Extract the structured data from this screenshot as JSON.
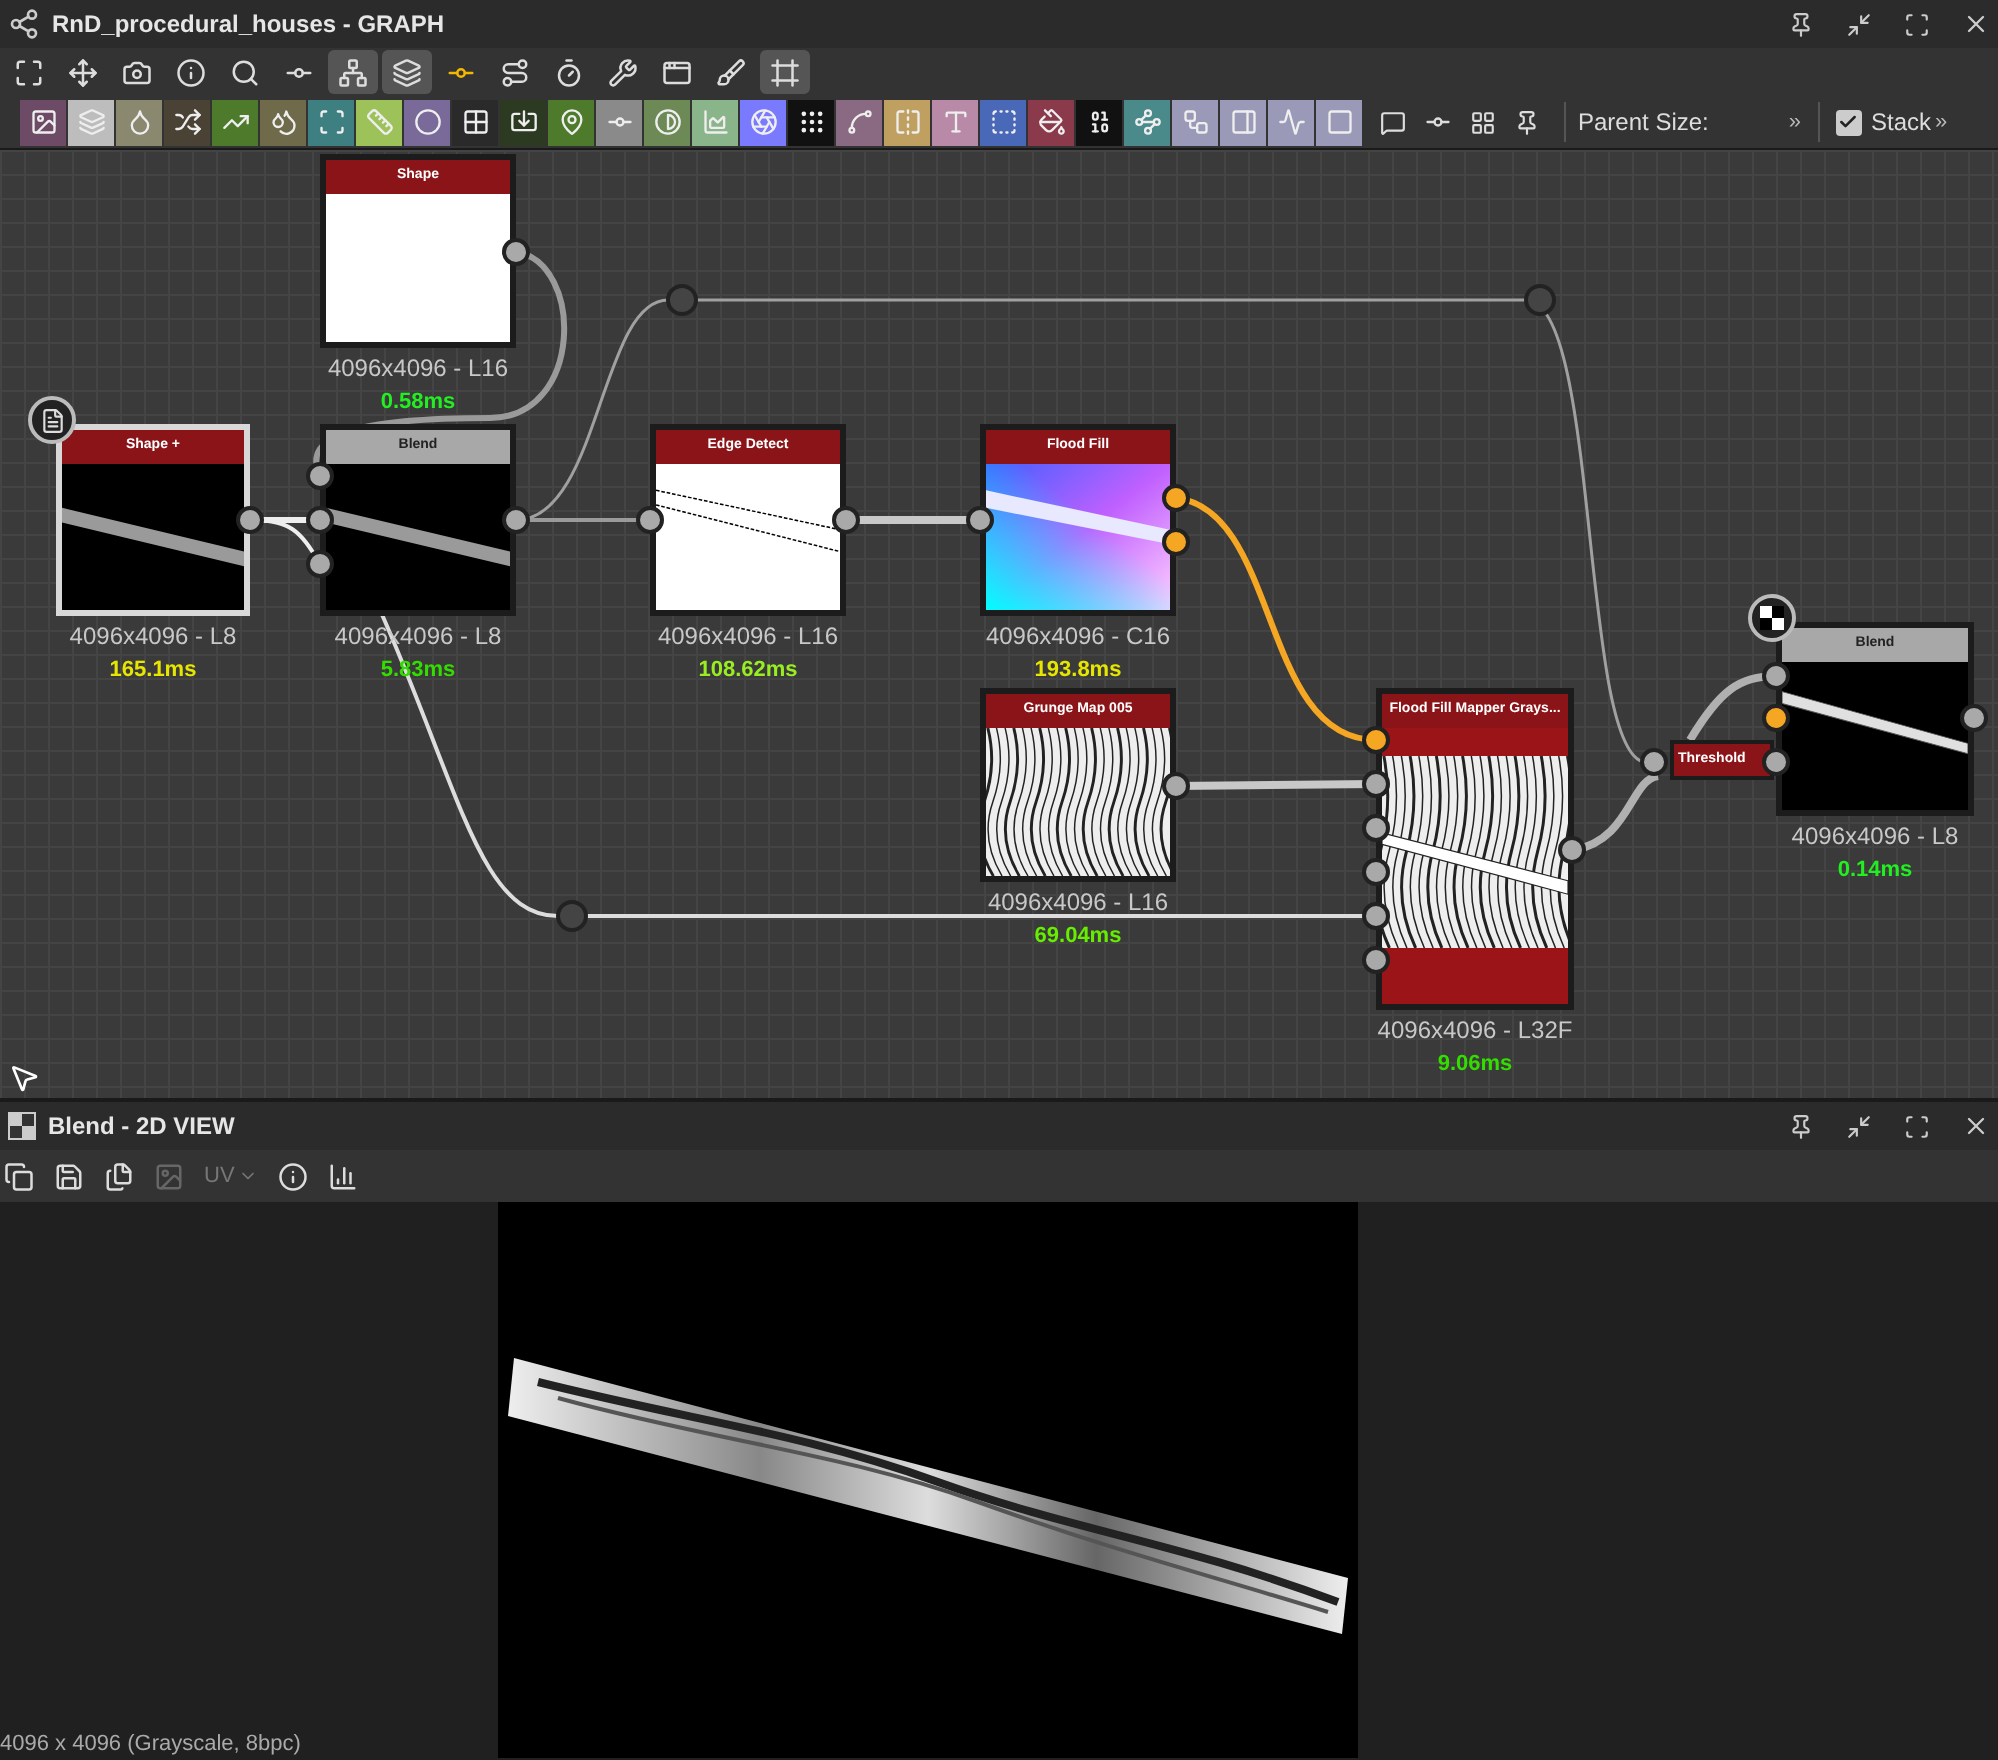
{
  "window": {
    "title": "RnD_procedural_houses - GRAPH"
  },
  "graph_toolbar": [
    {
      "selected": false
    },
    {
      "selected": false
    },
    {
      "selected": false
    },
    {
      "selected": false
    },
    {
      "selected": false
    },
    {
      "selected": false
    },
    {
      "selected": true
    },
    {
      "selected": true
    },
    {
      "selected": false
    },
    {
      "selected": false
    },
    {
      "selected": false
    },
    {
      "selected": false
    },
    {
      "selected": false
    },
    {
      "selected": false
    },
    {
      "selected": true
    }
  ],
  "node_palette": [
    {
      "color": "#6d4a66"
    },
    {
      "color": "#bdbdbd"
    },
    {
      "color": "#8b8870"
    },
    {
      "color": "#4a4234"
    },
    {
      "color": "#4e7a2c"
    },
    {
      "color": "#6f6a4a"
    },
    {
      "color": "#3e7f82"
    },
    {
      "color": "#9ec25a"
    },
    {
      "color": "#7a6a9a"
    },
    {
      "color": "#2a2a2a"
    },
    {
      "color": "#2c3a22"
    },
    {
      "color": "#4e7a2c"
    },
    {
      "color": "#8a8a8a"
    },
    {
      "color": "#6d8a56"
    },
    {
      "color": "#8ab48a"
    },
    {
      "color": "#7a7aff"
    },
    {
      "color": "#111111"
    },
    {
      "color": "#8a6a82"
    },
    {
      "color": "#c0a060"
    },
    {
      "color": "#b88aa8"
    },
    {
      "color": "#4a68b8"
    },
    {
      "color": "#8a3a4a"
    },
    {
      "color": "#111111"
    },
    {
      "color": "#4a8a8a"
    },
    {
      "color": "#9a9ab8"
    },
    {
      "color": "#9a9ab8"
    },
    {
      "color": "#9a9ab8"
    },
    {
      "color": "#9a9ab8"
    }
  ],
  "parent_size": {
    "label": "Parent Size:",
    "more": "»"
  },
  "stack": {
    "label": "Stack",
    "checked": true,
    "more": "»"
  },
  "nodes": [
    {
      "kind": "shape",
      "title": "Shape",
      "resolution": "4096x4096 - L16",
      "time": "0.58ms",
      "color": "#22ee22",
      "selected": false
    },
    {
      "kind": "shape_plus",
      "title": "Shape +",
      "resolution": "4096x4096 - L8",
      "time": "165.1ms",
      "color": "#e6e600",
      "selected": true
    },
    {
      "kind": "blend",
      "title": "Blend",
      "resolution": "4096x4096 - L8",
      "time": "5.83ms",
      "color": "#33dd00",
      "selected": false
    },
    {
      "kind": "edge",
      "title": "Edge Detect",
      "resolution": "4096x4096 - L16",
      "time": "108.62ms",
      "color": "#99ee22",
      "selected": false
    },
    {
      "kind": "flood",
      "title": "Flood Fill",
      "resolution": "4096x4096 - C16",
      "time": "193.8ms",
      "color": "#e6e600",
      "selected": false
    },
    {
      "kind": "grunge",
      "title": "Grunge Map 005",
      "resolution": "4096x4096 - L16",
      "time": "69.04ms",
      "color": "#66ee00",
      "selected": false
    },
    {
      "kind": "mapper",
      "title": "Flood Fill Mapper Grays...",
      "resolution": "4096x4096 - L32F",
      "time": "9.06ms",
      "color": "#33dd00",
      "selected": false
    },
    {
      "kind": "threshold",
      "title": "Threshold",
      "selected": false
    },
    {
      "kind": "blend_out",
      "title": "Blend",
      "resolution": "4096x4096 - L8",
      "time": "0.14ms",
      "color": "#22ee22",
      "selected": false
    }
  ],
  "view_panel": {
    "title": "Blend - 2D VIEW",
    "uv": "UV",
    "status": "4096 x 4096 (Grayscale, 8bpc)"
  }
}
